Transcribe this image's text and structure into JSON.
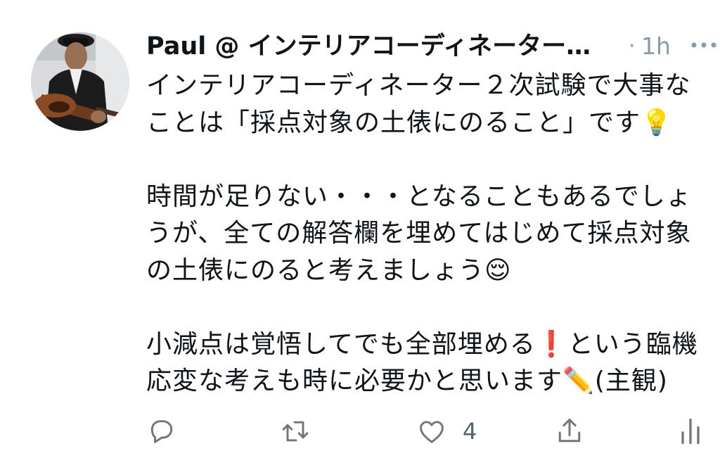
{
  "tweet": {
    "author_name": "Paul @ インテリアコーディネーター…",
    "separator": "·",
    "time": "1h",
    "text_paragraphs": [
      "インテリアコーディネーター２次試験で大事なことは「採点対象の土俵にのること」です💡",
      "時間が足りない・・・となることもあるでしょうが、全ての解答欄を埋めてはじめて採点対象の土俵にのると考えましょう😌",
      "小減点は覚悟してでも全部埋める❗️という臨機応変な考えも時に必要かと思います✏️(主観)"
    ]
  },
  "actions": {
    "reply_icon": "reply-icon",
    "retweet_icon": "retweet-icon",
    "like_icon": "heart-icon",
    "like_count": "4",
    "share_icon": "share-icon",
    "analytics_icon": "analytics-icon"
  },
  "colors": {
    "text": "#0f1419",
    "muted": "#8b98a5",
    "icon": "#71767b"
  }
}
